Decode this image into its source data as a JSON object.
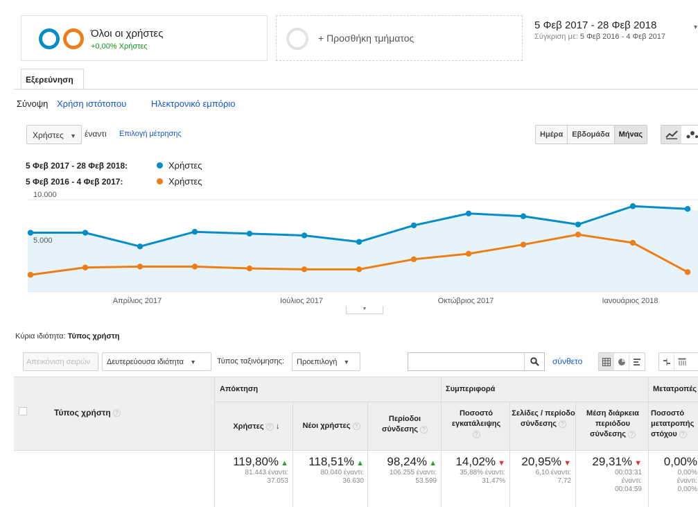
{
  "segments": {
    "all_users_title": "Όλοι οι χρήστες",
    "all_users_sub": "+0,00% Χρήστες",
    "add_segment": "+ Προσθήκη τμήματος"
  },
  "date_range": {
    "main": "5 Φεβ 2017 - 28 Φεβ 2018",
    "compare_label": "Σύγκριση με:",
    "compare_value": "5 Φεβ 2016 - 4 Φεβ 2017"
  },
  "tabs": {
    "explore": "Εξερεύνηση"
  },
  "subnav": {
    "overview": "Σύνοψη",
    "site_usage": "Χρήση ιστότοπου",
    "ecommerce": "Ηλεκτρονικό εμπόριο"
  },
  "chart_controls": {
    "metric": "Χρήστες",
    "vs": "έναντι",
    "pick_metric": "Επιλογή μέτρησης",
    "periods": [
      "Ημέρα",
      "Εβδομάδα",
      "Μήνας"
    ],
    "active_period": "Μήνας"
  },
  "legend": [
    {
      "range": "5 Φεβ 2017 - 28 Φεβ 2018:",
      "name": "Χρήστες",
      "color": "#058dc7"
    },
    {
      "range": "5 Φεβ 2016 - 4 Φεβ 2017:",
      "name": "Χρήστες",
      "color": "#ed7e17"
    }
  ],
  "chart_data": {
    "type": "line",
    "y_ticks": [
      "10.000",
      "5.000"
    ],
    "x_ticks": [
      "Απρίλιος 2017",
      "Ιούλιος 2017",
      "Οκτώβριος 2017",
      "Ιανουάριος 2018"
    ],
    "ylim": [
      0,
      10000
    ],
    "series": [
      {
        "name": "Χρήστες",
        "color": "#058dc7",
        "fill": true,
        "values": [
          6400,
          6400,
          4900,
          6500,
          6300,
          6100,
          5400,
          7200,
          8500,
          8200,
          7300,
          9300,
          9000
        ]
      },
      {
        "name": "Χρήστες",
        "color": "#ed7e17",
        "fill": false,
        "values": [
          1800,
          2600,
          2700,
          2700,
          2500,
          2400,
          2400,
          3500,
          4100,
          5100,
          6200,
          5300,
          2100
        ]
      }
    ]
  },
  "table": {
    "primary_dim_label": "Κύρια ιδιότητα:",
    "primary_dim_value": "Τύπος χρήστη",
    "plot_rows": "Απεικόνιση σειρών",
    "secondary_dim": "Δευτερεύουσα ιδιότητα",
    "sort_type_label": "Τύπος ταξινόμησης:",
    "sort_type_value": "Προεπιλογή",
    "advanced": "σύνθετο",
    "dim_header": "Τύπος χρήστη",
    "groups": [
      "Απόκτηση",
      "Συμπεριφορά",
      "Μετατροπές"
    ],
    "columns": [
      "Χρήστες",
      "Νέοι χρήστες",
      "Περίοδοι σύνδεσης",
      "Ποσοστό εγκατάλειψης",
      "Σελίδες / περίοδο σύνδεσης",
      "Μέση διάρκεια περιόδου σύνδεσης",
      "Ποσοστό μετατροπής στόχου"
    ],
    "totals": [
      {
        "pct": "119,80%",
        "dir": "up",
        "sub1": "81.443 έναντι:",
        "sub2": "37.053"
      },
      {
        "pct": "118,51%",
        "dir": "up",
        "sub1": "80.040 έναντι:",
        "sub2": "36.630"
      },
      {
        "pct": "98,24%",
        "dir": "up",
        "sub1": "106.255 έναντι:",
        "sub2": "53.599"
      },
      {
        "pct": "14,02%",
        "dir": "down",
        "sub1": "35,88% έναντι:",
        "sub2": "31,47%"
      },
      {
        "pct": "20,95%",
        "dir": "down",
        "sub1": "6,10 έναντι:",
        "sub2": "7,72"
      },
      {
        "pct": "29,31%",
        "dir": "down",
        "sub1": "00:03:31",
        "sub2": "έναντι:",
        "sub3": "00:04:59"
      },
      {
        "pct": "0,00%",
        "dir": "none",
        "sub1": "0,00%",
        "sub2": "έναντι:",
        "sub3": "0,00%"
      }
    ]
  }
}
